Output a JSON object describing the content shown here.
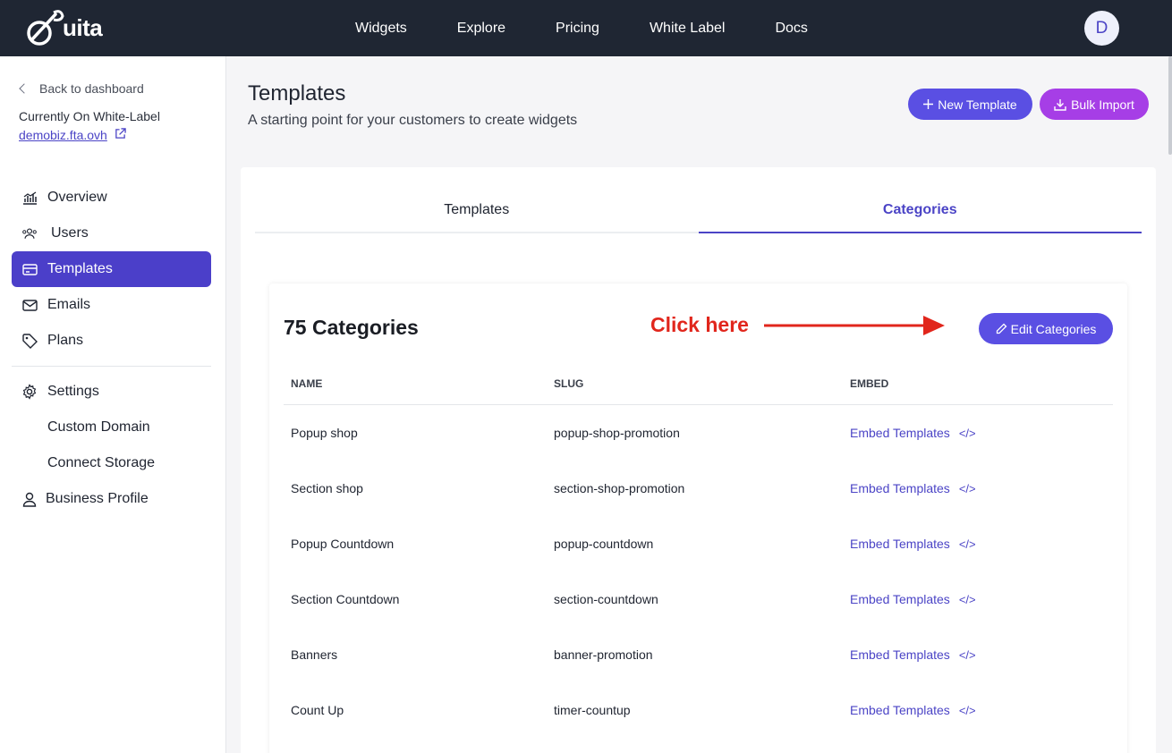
{
  "brand": {
    "name": "uita",
    "accent": "#4b3fc9",
    "purple": "#a63ee6",
    "annotation_color": "#e1261c"
  },
  "nav": {
    "items": [
      "Widgets",
      "Explore",
      "Pricing",
      "White Label",
      "Docs"
    ]
  },
  "user": {
    "initial": "D"
  },
  "sidebar": {
    "back_label": "Back to dashboard",
    "current_label": "Currently On White-Label",
    "domain": "demobiz.fta.ovh",
    "items": [
      {
        "label": "Overview",
        "icon": "chart-icon"
      },
      {
        "label": "Users",
        "icon": "users-icon"
      },
      {
        "label": "Templates",
        "icon": "card-icon",
        "active": true
      },
      {
        "label": "Emails",
        "icon": "mail-icon"
      },
      {
        "label": "Plans",
        "icon": "tag-icon"
      }
    ],
    "settings": {
      "label": "Settings",
      "children": [
        "Custom Domain",
        "Connect Storage"
      ]
    },
    "business_profile": "Business Profile"
  },
  "header": {
    "title": "Templates",
    "subtitle": "A starting point for your customers to create widgets",
    "new_button": "New Template",
    "bulk_button": "Bulk Import"
  },
  "tabs": [
    {
      "label": "Templates",
      "active": false
    },
    {
      "label": "Categories",
      "active": true
    }
  ],
  "categories": {
    "count_label": "75 Categories",
    "annotation": "Click here",
    "edit_button": "Edit Categories",
    "columns": [
      "NAME",
      "SLUG",
      "EMBED"
    ],
    "rows": [
      {
        "name": "Popup shop",
        "slug": "popup-shop-promotion",
        "embed": "Embed Templates"
      },
      {
        "name": "Section shop",
        "slug": "section-shop-promotion",
        "embed": "Embed Templates"
      },
      {
        "name": "Popup Countdown",
        "slug": "popup-countdown",
        "embed": "Embed Templates"
      },
      {
        "name": "Section Countdown",
        "slug": "section-countdown",
        "embed": "Embed Templates"
      },
      {
        "name": "Banners",
        "slug": "banner-promotion",
        "embed": "Embed Templates"
      },
      {
        "name": "Count Up",
        "slug": "timer-countup",
        "embed": "Embed Templates"
      }
    ]
  }
}
